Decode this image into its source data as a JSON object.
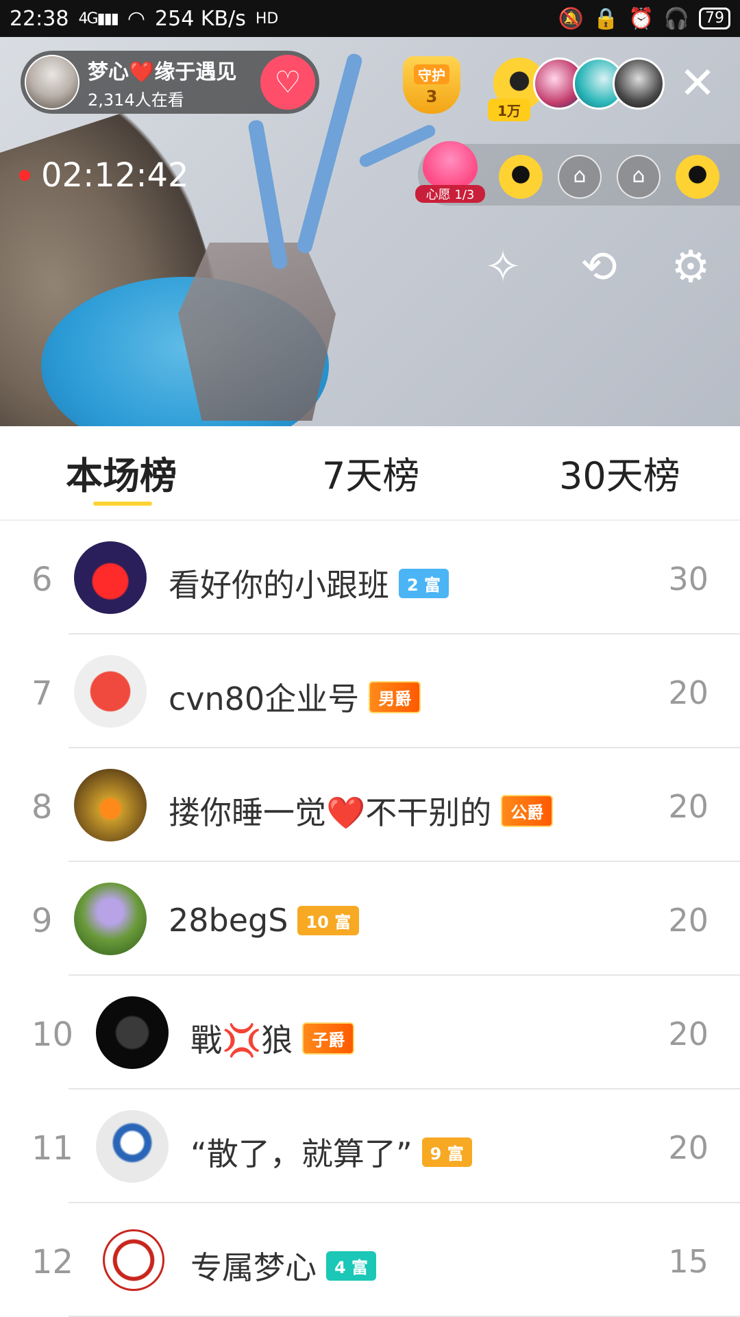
{
  "status_bar": {
    "time": "22:38",
    "network": "4G",
    "speed": "254 KB/s",
    "hd": "HD",
    "battery": "79"
  },
  "live": {
    "anchor_name": "梦心❤️缘于遇见",
    "viewers": "2,314人在看",
    "guard_label": "守护",
    "guard_count": "3",
    "top_user_tag": "1万",
    "timer": "02:12:42",
    "wish_label": "心愿 1/3"
  },
  "tabs": [
    {
      "label": "本场榜"
    },
    {
      "label": "7天榜"
    },
    {
      "label": "30天榜"
    }
  ],
  "ranking": [
    {
      "rank": "6",
      "name": "看好你的小跟班",
      "badge": "2 富",
      "badge_type": "rich-blue",
      "score": "30"
    },
    {
      "rank": "7",
      "name": "cvn80企业号",
      "badge": "男爵",
      "badge_type": "noble",
      "score": "20"
    },
    {
      "rank": "8",
      "name": "搂你睡一觉❤️不干别的",
      "badge": "公爵",
      "badge_type": "noble",
      "score": "20"
    },
    {
      "rank": "9",
      "name": "28begS",
      "badge": "10 富",
      "badge_type": "rich-orange",
      "score": "20"
    },
    {
      "rank": "10",
      "name": "戰💢狼",
      "badge": "子爵",
      "badge_type": "noble",
      "score": "20"
    },
    {
      "rank": "11",
      "name": "“散了，就算了”",
      "badge": "9 富",
      "badge_type": "rich-orange",
      "score": "20"
    },
    {
      "rank": "12",
      "name": "专属梦心",
      "badge": "4 富",
      "badge_type": "rich-teal",
      "score": "15"
    }
  ],
  "icons": {
    "close": "close-icon",
    "follow": "heart-plus-icon",
    "beauty": "magic-wand-icon",
    "camera_switch": "camera-switch-icon",
    "settings": "gear-icon",
    "seat": "sofa-icon"
  },
  "colors": {
    "accent": "#ffd233",
    "live_dot": "#ff2b2b",
    "follow": "#ff4e6a"
  }
}
